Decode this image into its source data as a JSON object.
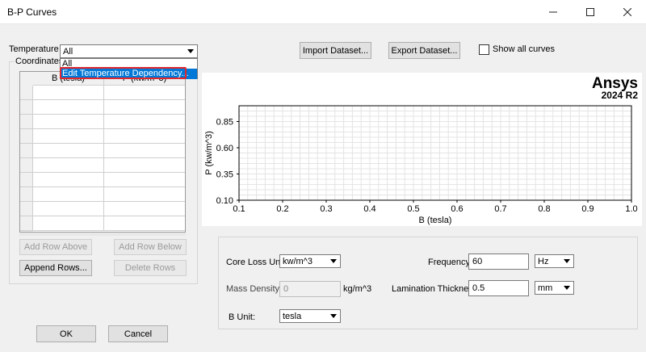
{
  "window": {
    "title": "B-P Curves",
    "minimize_icon": "minimize-icon",
    "maximize_icon": "maximize-icon",
    "close_icon": "close-icon"
  },
  "temperature": {
    "label": "Temperature",
    "selected": "All",
    "dropdown_options": [
      "All",
      "Edit Temperature Dependency..."
    ],
    "highlighted_option": "Edit Temperature Dependency..."
  },
  "coordinates": {
    "group_label": "Coordinates",
    "columns": [
      "B (tesla)",
      "P (kw/m^3)"
    ],
    "row_count": 10
  },
  "row_buttons": {
    "add_above": "Add Row Above",
    "add_below": "Add Row Below",
    "append": "Append Rows...",
    "delete": "Delete Rows"
  },
  "toolbar": {
    "import": "Import Dataset...",
    "export": "Export Dataset...",
    "show_all_curves": "Show all curves",
    "show_all_checked": false
  },
  "chart_data": {
    "type": "line",
    "brand": "Ansys",
    "version": "2024 R2",
    "xlabel": "B (tesla)",
    "ylabel": "P (kw/m^3)",
    "xlim": [
      0.1,
      1.0
    ],
    "ylim": [
      0.1,
      1.0
    ],
    "xticks": [
      "0.1",
      "0.2",
      "0.3",
      "0.4",
      "0.5",
      "0.6",
      "0.7",
      "0.8",
      "0.9",
      "1.0"
    ],
    "yticks": [
      "0.85",
      "0.60",
      "0.35",
      "0.10"
    ],
    "grid": true,
    "series": []
  },
  "properties": {
    "core_loss_unit_label": "Core Loss Unit:",
    "core_loss_unit": "kw/m^3",
    "mass_density_label": "Mass Density:",
    "mass_density": "0",
    "mass_density_unit": "kg/m^3",
    "b_unit_label": "B Unit:",
    "b_unit": "tesla",
    "frequency_label": "Frequency:",
    "frequency": "60",
    "frequency_unit": "Hz",
    "lamination_label": "Lamination Thickness",
    "lamination": "0.5",
    "lamination_unit": "mm"
  },
  "footer": {
    "ok": "OK",
    "cancel": "Cancel"
  },
  "colors": {
    "highlight": "#0078d7",
    "focus_ring": "#e0282e"
  }
}
